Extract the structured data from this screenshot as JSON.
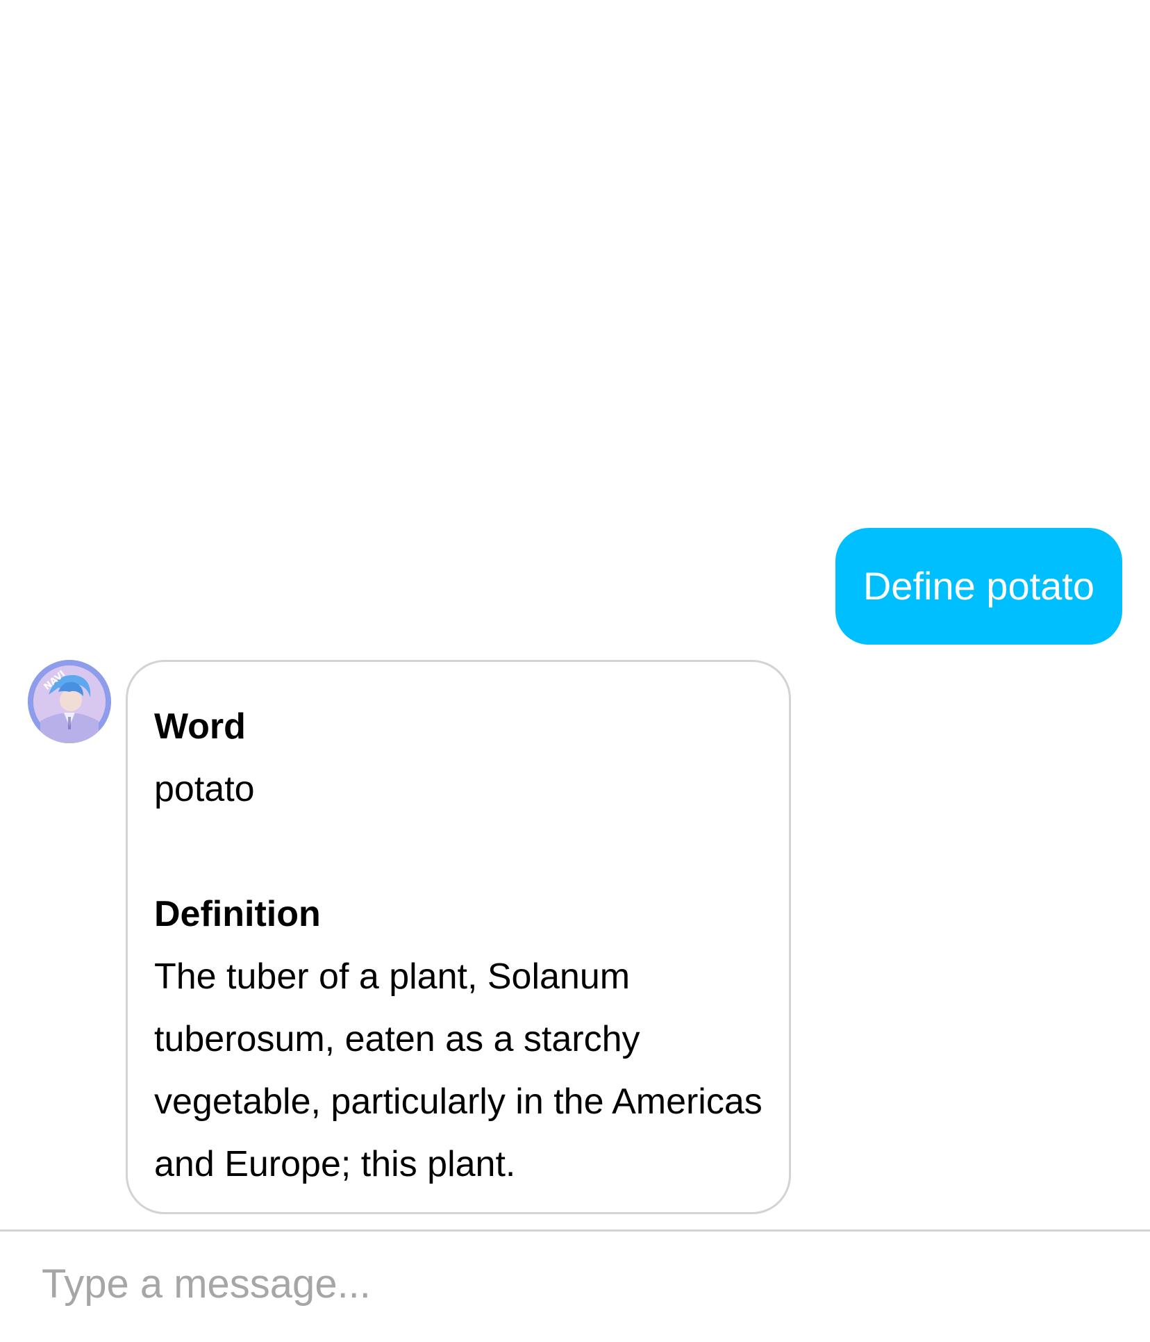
{
  "conversation": {
    "user_message": "Define potato",
    "bot_reply": {
      "word_label": "Word",
      "word_value": "potato",
      "definition_label": "Definition",
      "definition_value": "The tuber of a plant, Solanum tuberosum, eaten as a starchy vegetable, particularly in the Americas and Europe; this plant."
    },
    "avatar": {
      "icon": "bot-avatar-icon",
      "badge_text": "NAVI"
    }
  },
  "composer": {
    "placeholder": "Type a message..."
  },
  "colors": {
    "user_bubble": "#00bfff",
    "bot_bubble_border": "#d3d3d3",
    "avatar_ring": "#8e9cec",
    "placeholder": "#a6a6a6"
  }
}
